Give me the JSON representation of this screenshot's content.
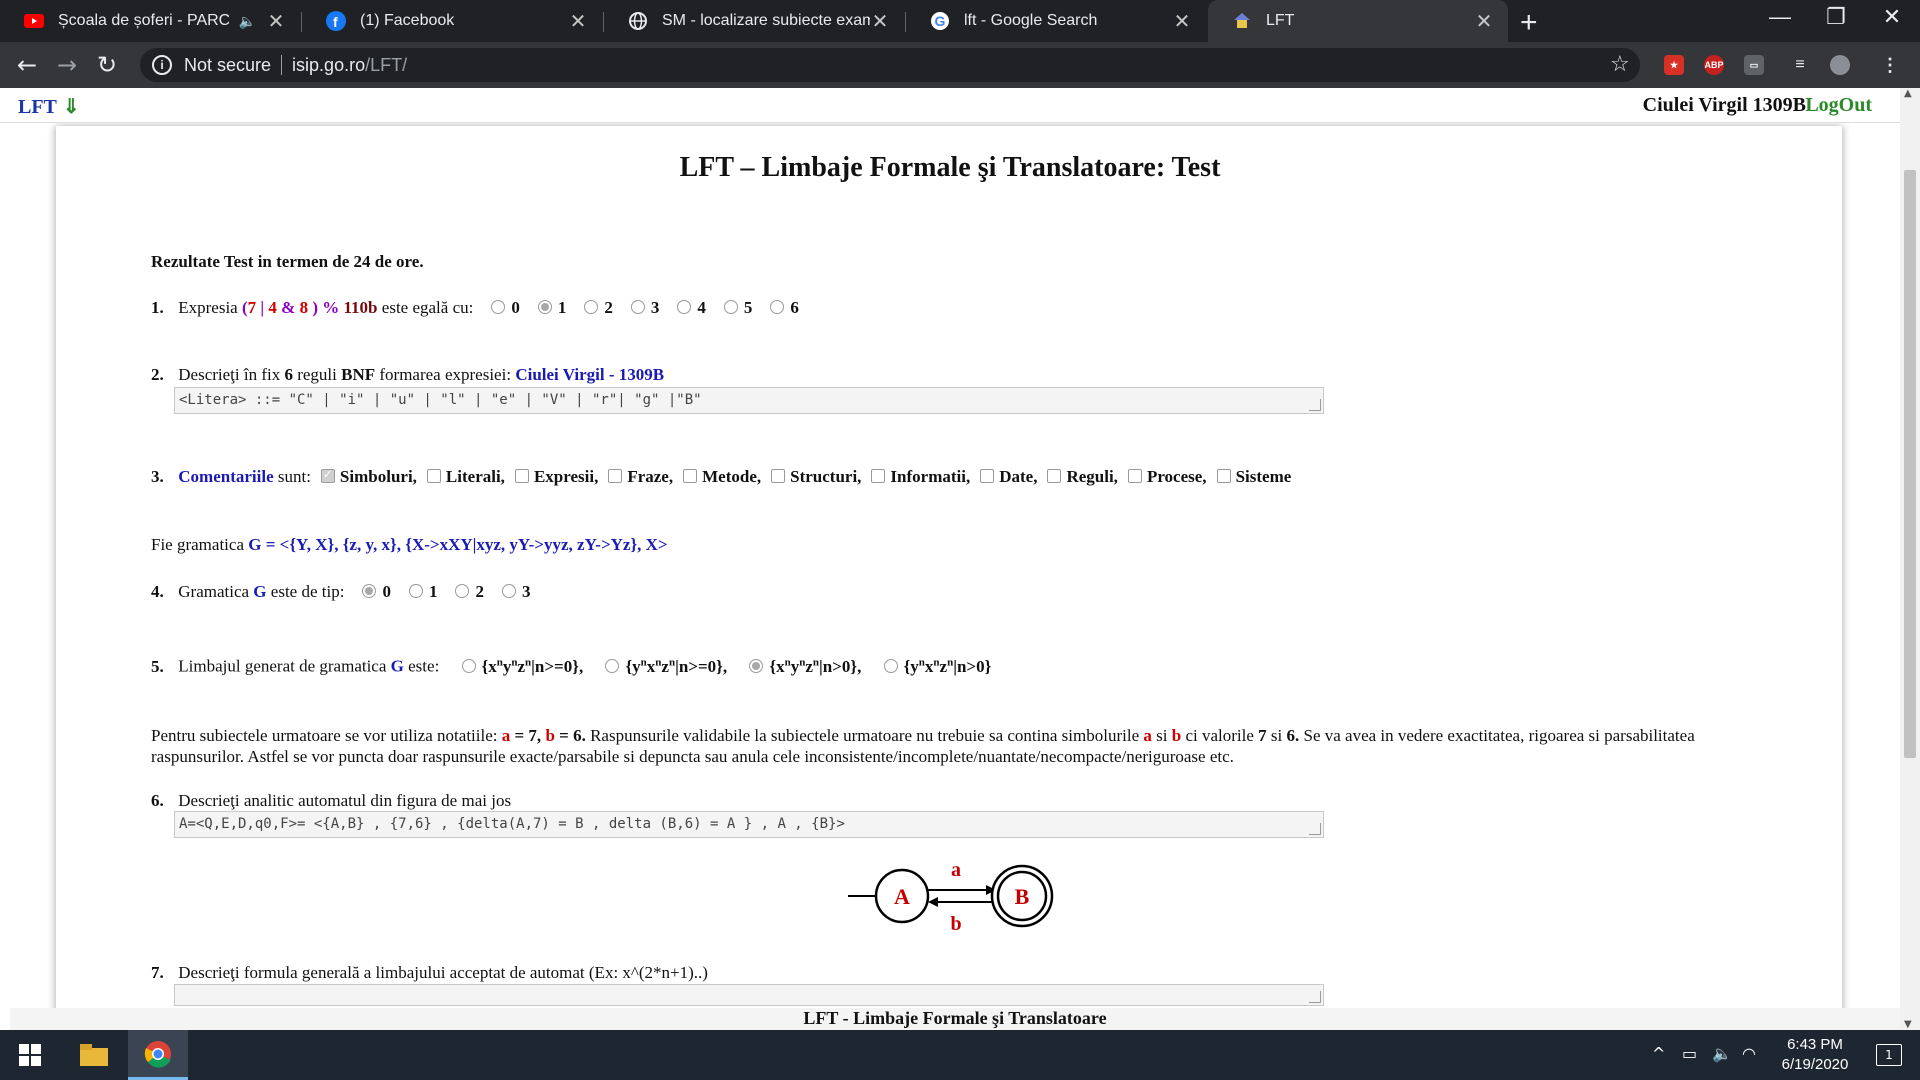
{
  "browser": {
    "tabs": [
      {
        "title": "Școala de șoferi - PARCĂRI -",
        "icon": "youtube-icon",
        "audio": "🔈",
        "active": false
      },
      {
        "title": "(1) Facebook",
        "icon": "facebook-icon",
        "active": false
      },
      {
        "title": "SM - localizare subiecte examen",
        "icon": "globe-icon",
        "active": false
      },
      {
        "title": "lft - Google Search",
        "icon": "google-icon",
        "active": false
      },
      {
        "title": "LFT",
        "icon": "lft-icon",
        "active": true
      }
    ],
    "new_tab": "+",
    "window_controls": {
      "minimize": "—",
      "restore": "❐",
      "close": "✕"
    },
    "address": {
      "security": "Not secure",
      "host": "isip.go.ro",
      "path": "/LFT/"
    },
    "extensions": [
      "ABP"
    ]
  },
  "topbar": {
    "brand": "LFT",
    "brand_arrow": "⇓",
    "user": "Ciulei Virgil 1309B",
    "logout": "LogOut"
  },
  "page_title": "LFT – Limbaje Formale şi Translatoare: Test",
  "intro": "Rezultate Test in termen de 24 de ore.",
  "q1": {
    "num": "1.",
    "pre": "Expresia",
    "expr": {
      "open": "(",
      "a": "7",
      "op1": "|",
      "b": "4",
      "op2": "&",
      "c": "8",
      "close": ")",
      "op3": "%",
      "d": "110b"
    },
    "post": "este egală cu:",
    "options": [
      "0",
      "1",
      "2",
      "3",
      "4",
      "5",
      "6"
    ],
    "selected": 1
  },
  "q2": {
    "num": "2.",
    "pre": "Descrieţi în fix",
    "count": "6",
    "mid": "reguli",
    "bnf": "BNF",
    "post": "formarea expresiei:",
    "target": "Ciulei Virgil - 1309B",
    "answer": "<Litera> ::= \"C\" | \"i\" | \"u\" | \"l\" | \"e\" | \"V\" | \"r\"| \"g\" |\"B\""
  },
  "q3": {
    "num": "3.",
    "label": "Comentariile",
    "post": "sunt:",
    "options": [
      "Simboluri,",
      "Literali,",
      "Expresii,",
      "Fraze,",
      "Metode,",
      "Structuri,",
      "Informatii,",
      "Date,",
      "Reguli,",
      "Procese,",
      "Sisteme"
    ],
    "checked": [
      0
    ]
  },
  "grammar": {
    "pre": "Fie gramatica",
    "def": "G = <{Y, X}, {z, y, x}, {X->xXY|xyz, yY->yyz, zY->Yz}, X>"
  },
  "q4": {
    "num": "4.",
    "pre": "Gramatica",
    "g": "G",
    "post": "este de tip:",
    "options": [
      "0",
      "1",
      "2",
      "3"
    ],
    "selected": 0
  },
  "q5": {
    "num": "5.",
    "pre": "Limbajul generat de gramatica",
    "g": "G",
    "post": "este:",
    "options": [
      {
        "p": [
          "x",
          "y",
          "z"
        ],
        "cond": "|n>=0},"
      },
      {
        "p": [
          "y",
          "x",
          "z"
        ],
        "cond": "|n>=0},"
      },
      {
        "p": [
          "x",
          "y",
          "z"
        ],
        "cond": "|n>0},"
      },
      {
        "p": [
          "y",
          "x",
          "z"
        ],
        "cond": "|n>0}"
      }
    ],
    "sup": "n",
    "selected": 2
  },
  "notation": {
    "p1": "Pentru subiectele urmatoare se vor utiliza notatiile:",
    "a": "a",
    "eq_a": "= 7,",
    "b": "b",
    "eq_b": "= 6.",
    "p2": "Raspunsurile validabile la subiectele urmatoare nu trebuie sa contina simbolurile",
    "a2": "a",
    "si": "si",
    "b2": "b",
    "p3": "ci valorile",
    "v7": "7",
    "si2": "si",
    "v6": "6.",
    "p4": "Se va avea in vedere exactitatea, rigoarea si parsabilitatea raspunsurilor. Astfel se vor puncta doar raspunsurile exacte/parsabile si depuncta sau anula cele inconsistente/incomplete/nuantate/necompacte/neriguroase etc."
  },
  "q6": {
    "num": "6.",
    "text": "Descrieţi analitic automatul din figura de mai jos",
    "answer": "A=<Q,E,D,q0,F>= <{A,B} , {7,6} , {delta(A,7) = B , delta (B,6) = A } , A , {B}>"
  },
  "automaton": {
    "states": [
      "A",
      "B"
    ],
    "edge_top": "a",
    "edge_bottom": "b",
    "colors": {
      "label": "#c40000",
      "line": "#000000"
    }
  },
  "q7": {
    "num": "7.",
    "text": "Descrieţi formula generală a limbajului acceptat de automat (Ex: x^(2*n+1)..)",
    "answer": ""
  },
  "footer": "LFT - Limbaje Formale şi Translatoare",
  "taskbar": {
    "time": "6:43 PM",
    "date": "6/19/2020",
    "notifications": "1"
  }
}
